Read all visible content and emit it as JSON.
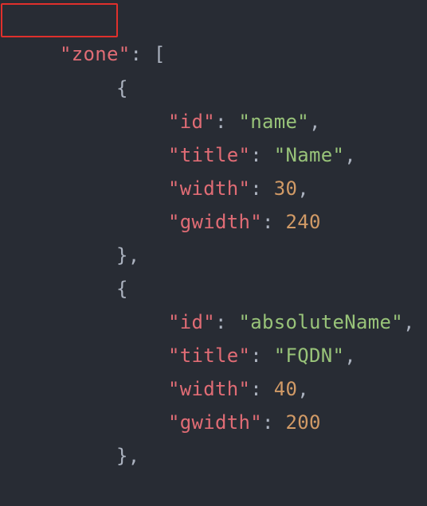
{
  "code": {
    "zone_key": "\"zone\"",
    "colon": ":",
    "comma": ",",
    "open_bracket": "[",
    "open_brace": "{",
    "close_brace": "},",
    "items": [
      {
        "id_key": "\"id\"",
        "id_val": "\"name\"",
        "title_key": "\"title\"",
        "title_val": "\"Name\"",
        "width_key": "\"width\"",
        "width_val": "30",
        "gwidth_key": "\"gwidth\"",
        "gwidth_val": "240"
      },
      {
        "id_key": "\"id\"",
        "id_val": "\"absoluteName\"",
        "title_key": "\"title\"",
        "title_val": "\"FQDN\"",
        "width_key": "\"width\"",
        "width_val": "40",
        "gwidth_key": "\"gwidth\"",
        "gwidth_val": "200"
      }
    ]
  },
  "colors": {
    "background": "#282c34",
    "key": "#e06c75",
    "string": "#98c379",
    "number": "#d19a66",
    "punctuation": "#abb2bf",
    "highlight": "#e0302c"
  }
}
